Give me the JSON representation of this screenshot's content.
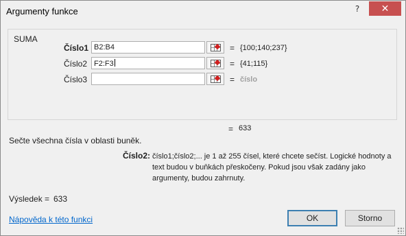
{
  "window": {
    "title": "Argumenty funkce",
    "help_glyph": "?",
    "close_glyph": "✕"
  },
  "function": {
    "name": "SUMA",
    "arguments": [
      {
        "label": "Číslo1",
        "value": "B2:B4",
        "result": "{100;140;237}",
        "bold": true
      },
      {
        "label": "Číslo2",
        "value": "F2:F3",
        "result": "{41;115}",
        "bold": false
      },
      {
        "label": "Číslo3",
        "value": "",
        "result": "číslo",
        "bold": false
      }
    ],
    "equals": "=",
    "formula_result": "633",
    "description": "Sečte všechna čísla v oblasti buněk.",
    "detail_label": "Číslo2:",
    "detail_text": "číslo1;číslo2;... je 1 až 255 čísel, které chcete sečíst. Logické hodnoty a text budou v buňkách přeskočeny. Pokud jsou však zadány jako argumenty, budou zahrnuty."
  },
  "result": {
    "label": "Výsledek =",
    "value": "633"
  },
  "footer": {
    "help_link": "Nápověda k této funkci",
    "ok_label": "OK",
    "cancel_label": "Storno"
  },
  "icons": {
    "collapse": "collapse-dialog-icon"
  },
  "colors": {
    "close_button": "#c75050",
    "link": "#0066cc",
    "default_button_border": "#3c7fb1"
  }
}
